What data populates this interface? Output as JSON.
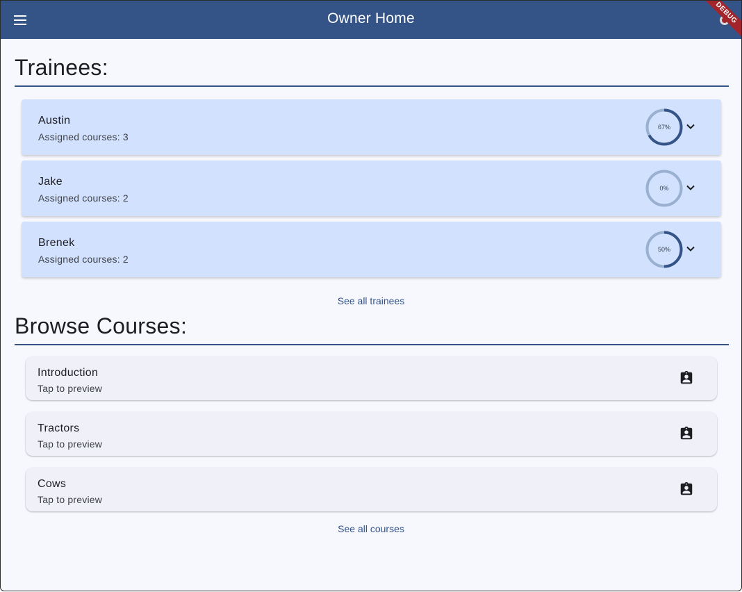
{
  "appbar": {
    "title": "Owner Home",
    "debug_label": "DEBUG",
    "menu_icon": "hamburger-menu-icon"
  },
  "trainees": {
    "heading": "Trainees:",
    "items": [
      {
        "name": "Austin",
        "subtitle": "Assigned courses: 3",
        "progress_label": "67%",
        "progress": 0.67
      },
      {
        "name": "Jake",
        "subtitle": "Assigned courses: 2",
        "progress_label": "0%",
        "progress": 0.0
      },
      {
        "name": "Brenek",
        "subtitle": "Assigned courses: 2",
        "progress_label": "50%",
        "progress": 0.5
      }
    ],
    "see_all": "See all trainees"
  },
  "courses": {
    "heading": "Browse Courses:",
    "items": [
      {
        "name": "Introduction",
        "subtitle": "Tap to preview"
      },
      {
        "name": "Tractors",
        "subtitle": "Tap to preview"
      },
      {
        "name": "Cows",
        "subtitle": "Tap to preview"
      }
    ],
    "item_icon": "assignment-ind-icon",
    "see_all": "See all courses"
  },
  "colors": {
    "primary": "#345488",
    "trainee_card": "#d2e1fd",
    "course_card": "#f0f0f9",
    "background": "#f7f8fe",
    "ring_track": "#9ab0d0",
    "debug_banner": "#a1252b"
  }
}
